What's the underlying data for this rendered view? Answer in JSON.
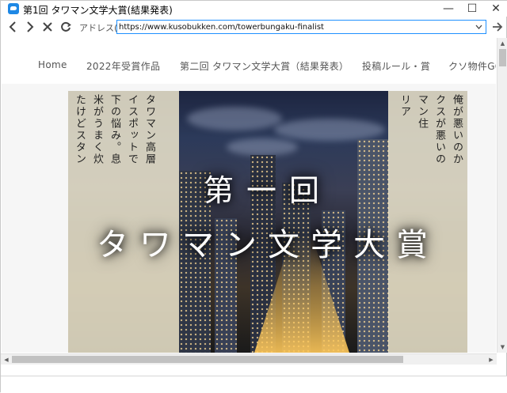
{
  "window": {
    "title": "第1回 タワマン文学大賞(結果発表)",
    "controls": {
      "minimize": "—",
      "maximize": "☐",
      "close": "✕"
    }
  },
  "toolbar": {
    "back_icon": "back-arrow-icon",
    "forward_icon": "forward-arrow-icon",
    "stop_icon": "stop-icon",
    "refresh_icon": "refresh-icon",
    "address_label": "アドレス(D)",
    "url": "https://www.kusobukken.com/towerbungaku-finalist",
    "go_icon": "go-arrow-icon"
  },
  "site_nav": {
    "items": [
      {
        "label": "Home"
      },
      {
        "label": "2022年受賞作品"
      },
      {
        "label": "第二回 タワマン文学大賞（結果発表）"
      },
      {
        "label": "投稿ルール・賞"
      },
      {
        "label": "クソ物件GO"
      }
    ]
  },
  "hero": {
    "title_line1": "第一回",
    "title_line2": "タワマン文学大賞",
    "left_columns": [
      "たけどスタン",
      "米がうまく炊",
      "下の悩み。息",
      "イスポットで",
      "タワマン高層"
    ],
    "right_columns": [
      "俺が悪いのか",
      "クスが悪いの",
      "マン住",
      "リア"
    ],
    "colors": {
      "paper": "#ece5cd",
      "night_sky": "#1d2540",
      "lights": "#ffdc96"
    }
  }
}
